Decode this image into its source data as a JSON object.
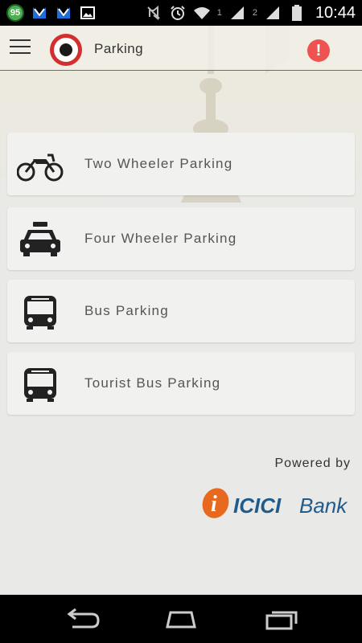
{
  "status_bar": {
    "badge": "95",
    "sim1": "1",
    "sim2": "2",
    "time": "10:44"
  },
  "header": {
    "title": "Parking"
  },
  "menu": [
    {
      "label": "Two Wheeler Parking",
      "icon": "motorcycle-icon"
    },
    {
      "label": "Four Wheeler Parking",
      "icon": "taxi-icon"
    },
    {
      "label": "Bus Parking",
      "icon": "bus-icon"
    },
    {
      "label": "Tourist Bus Parking",
      "icon": "tourist-bus-icon"
    }
  ],
  "footer": {
    "powered_by": "Powered by",
    "bank_name_part1": "ICICI",
    "bank_name_part2": "Bank"
  },
  "colors": {
    "logo_red": "#d32f2f",
    "alert": "#ef5350",
    "icici_orange": "#e8691e",
    "icici_blue": "#1f5c8c"
  }
}
